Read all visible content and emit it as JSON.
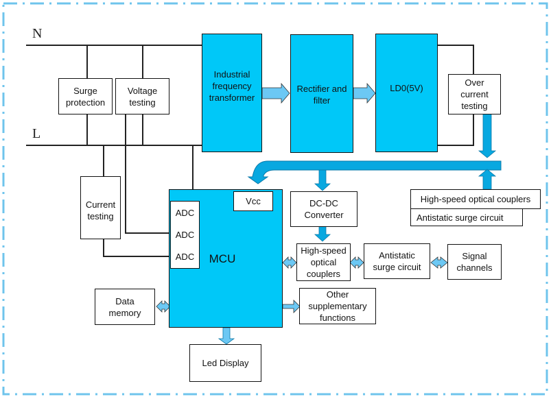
{
  "diagram": {
    "lines": {
      "neutral": "N",
      "live": "L"
    },
    "blocks": {
      "surge_protection": "Surge\nprotection",
      "voltage_testing": "Voltage\ntesting",
      "transformer": "Industrial\nfrequency\ntransformer",
      "rectifier": "Rectifier and\nfilter",
      "ldo": "LD0(5V)",
      "over_current": "Over\ncurrent\ntesting",
      "current_testing": "Current\ntesting",
      "mcu": "MCU",
      "vcc": "Vcc",
      "adc": [
        "ADC",
        "ADC",
        "ADC"
      ],
      "dcdc": "DC-DC\nConverter",
      "hs_couplers_top": "High-speed optical couplers",
      "antistatic_top": "Antistatic surge circuit",
      "hs_couplers": "High-speed\noptical\ncouplers",
      "antistatic": "Antistatic\nsurge circuit",
      "signal_channels": "Signal\nchannels",
      "data_memory": "Data\nmemory",
      "other_functions": "Other\nsupplementary\nfunctions",
      "led_display": "Led Display"
    },
    "colors": {
      "block_fill": "#00c8f8",
      "arrow_fill": "#6cc8f4",
      "bus_fill": "#08a8e0",
      "border_dash": "#6fc4ec"
    }
  }
}
